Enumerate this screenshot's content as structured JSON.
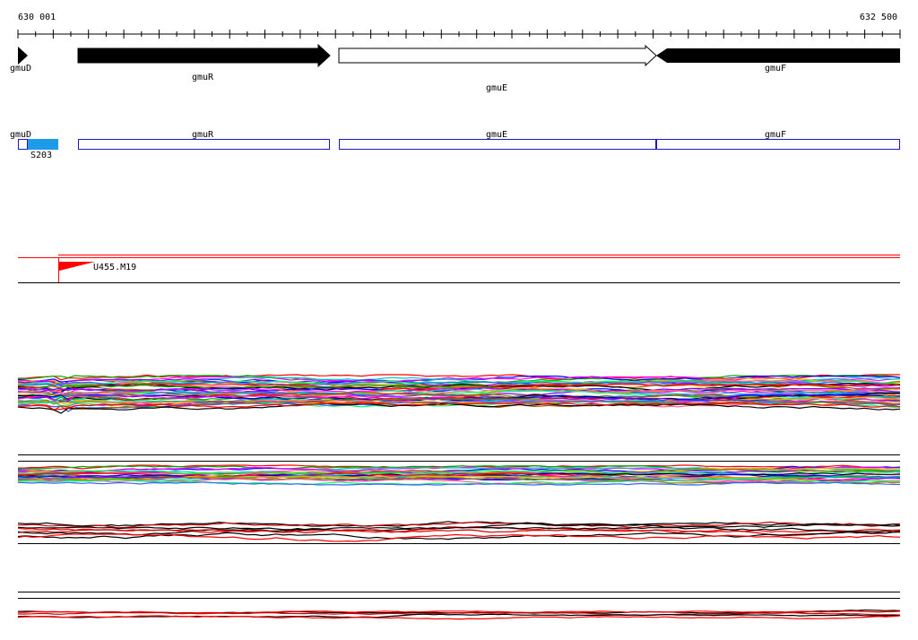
{
  "ruler": {
    "start_label": "630 001",
    "end_label": "632 500"
  },
  "genes": [
    {
      "name": "gmuD",
      "strand": "+",
      "fill": "#000000"
    },
    {
      "name": "gmuR",
      "strand": "+",
      "fill": "#000000"
    },
    {
      "name": "gmuE",
      "strand": "+",
      "fill": "#ffffff"
    },
    {
      "name": "gmuF",
      "strand": "+",
      "fill": "#000000"
    }
  ],
  "annotations": [
    {
      "name": "gmuD",
      "color": "#1a1acc"
    },
    {
      "name": "gmuR",
      "color": "#1a1acc"
    },
    {
      "name": "gmuE",
      "color": "#1a1acc"
    },
    {
      "name": "gmuF",
      "color": "#1a1acc"
    }
  ],
  "feature": {
    "label": "S203",
    "color": "#1e9be8"
  },
  "tss": {
    "label": "U455.M19",
    "color": "#ff0000"
  },
  "colors": {
    "track_lines": "#000000",
    "tss_line": "#ff0000",
    "profile_palette": [
      "#ff0000",
      "#00aa00",
      "#0000ff",
      "#ff00ff",
      "#00cccc",
      "#ffaa00",
      "#8800ff",
      "#888800",
      "#ff6688",
      "#00ff66",
      "#3366ff",
      "#aa5500",
      "#000000"
    ]
  }
}
